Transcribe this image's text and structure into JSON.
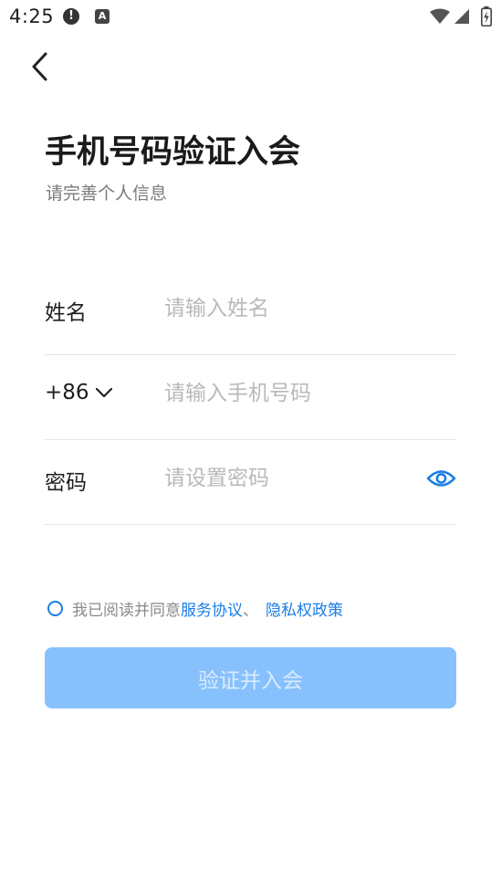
{
  "status_bar": {
    "time": "4:25",
    "icons": [
      "alert-icon",
      "a-badge-icon",
      "wifi-icon",
      "signal-icon",
      "battery-charging-icon"
    ],
    "alert_glyph": "!",
    "a_glyph": "A"
  },
  "header": {
    "back_icon": "chevron-left-icon",
    "title": "手机号码验证入会",
    "subtitle": "请完善个人信息"
  },
  "form": {
    "name": {
      "label": "姓名",
      "placeholder": "请输入姓名",
      "value": ""
    },
    "phone": {
      "country_code": "+86",
      "country_code_icon": "chevron-down-icon",
      "placeholder": "请输入手机号码",
      "value": ""
    },
    "password": {
      "label": "密码",
      "placeholder": "请设置密码",
      "value": "",
      "toggle_icon": "eye-icon"
    }
  },
  "agreement": {
    "checked": false,
    "prefix": "我已阅读并同意",
    "terms_link": "服务协议",
    "separator": "、",
    "privacy_link": "隐私权政策"
  },
  "submit": {
    "label": "验证并入会",
    "enabled": false
  },
  "colors": {
    "accent": "#1a7ee6",
    "button_disabled_bg": "#87c1fd",
    "button_disabled_text": "#d9ebfe",
    "placeholder": "#b9b9b9",
    "divider": "#e5e5e5"
  }
}
